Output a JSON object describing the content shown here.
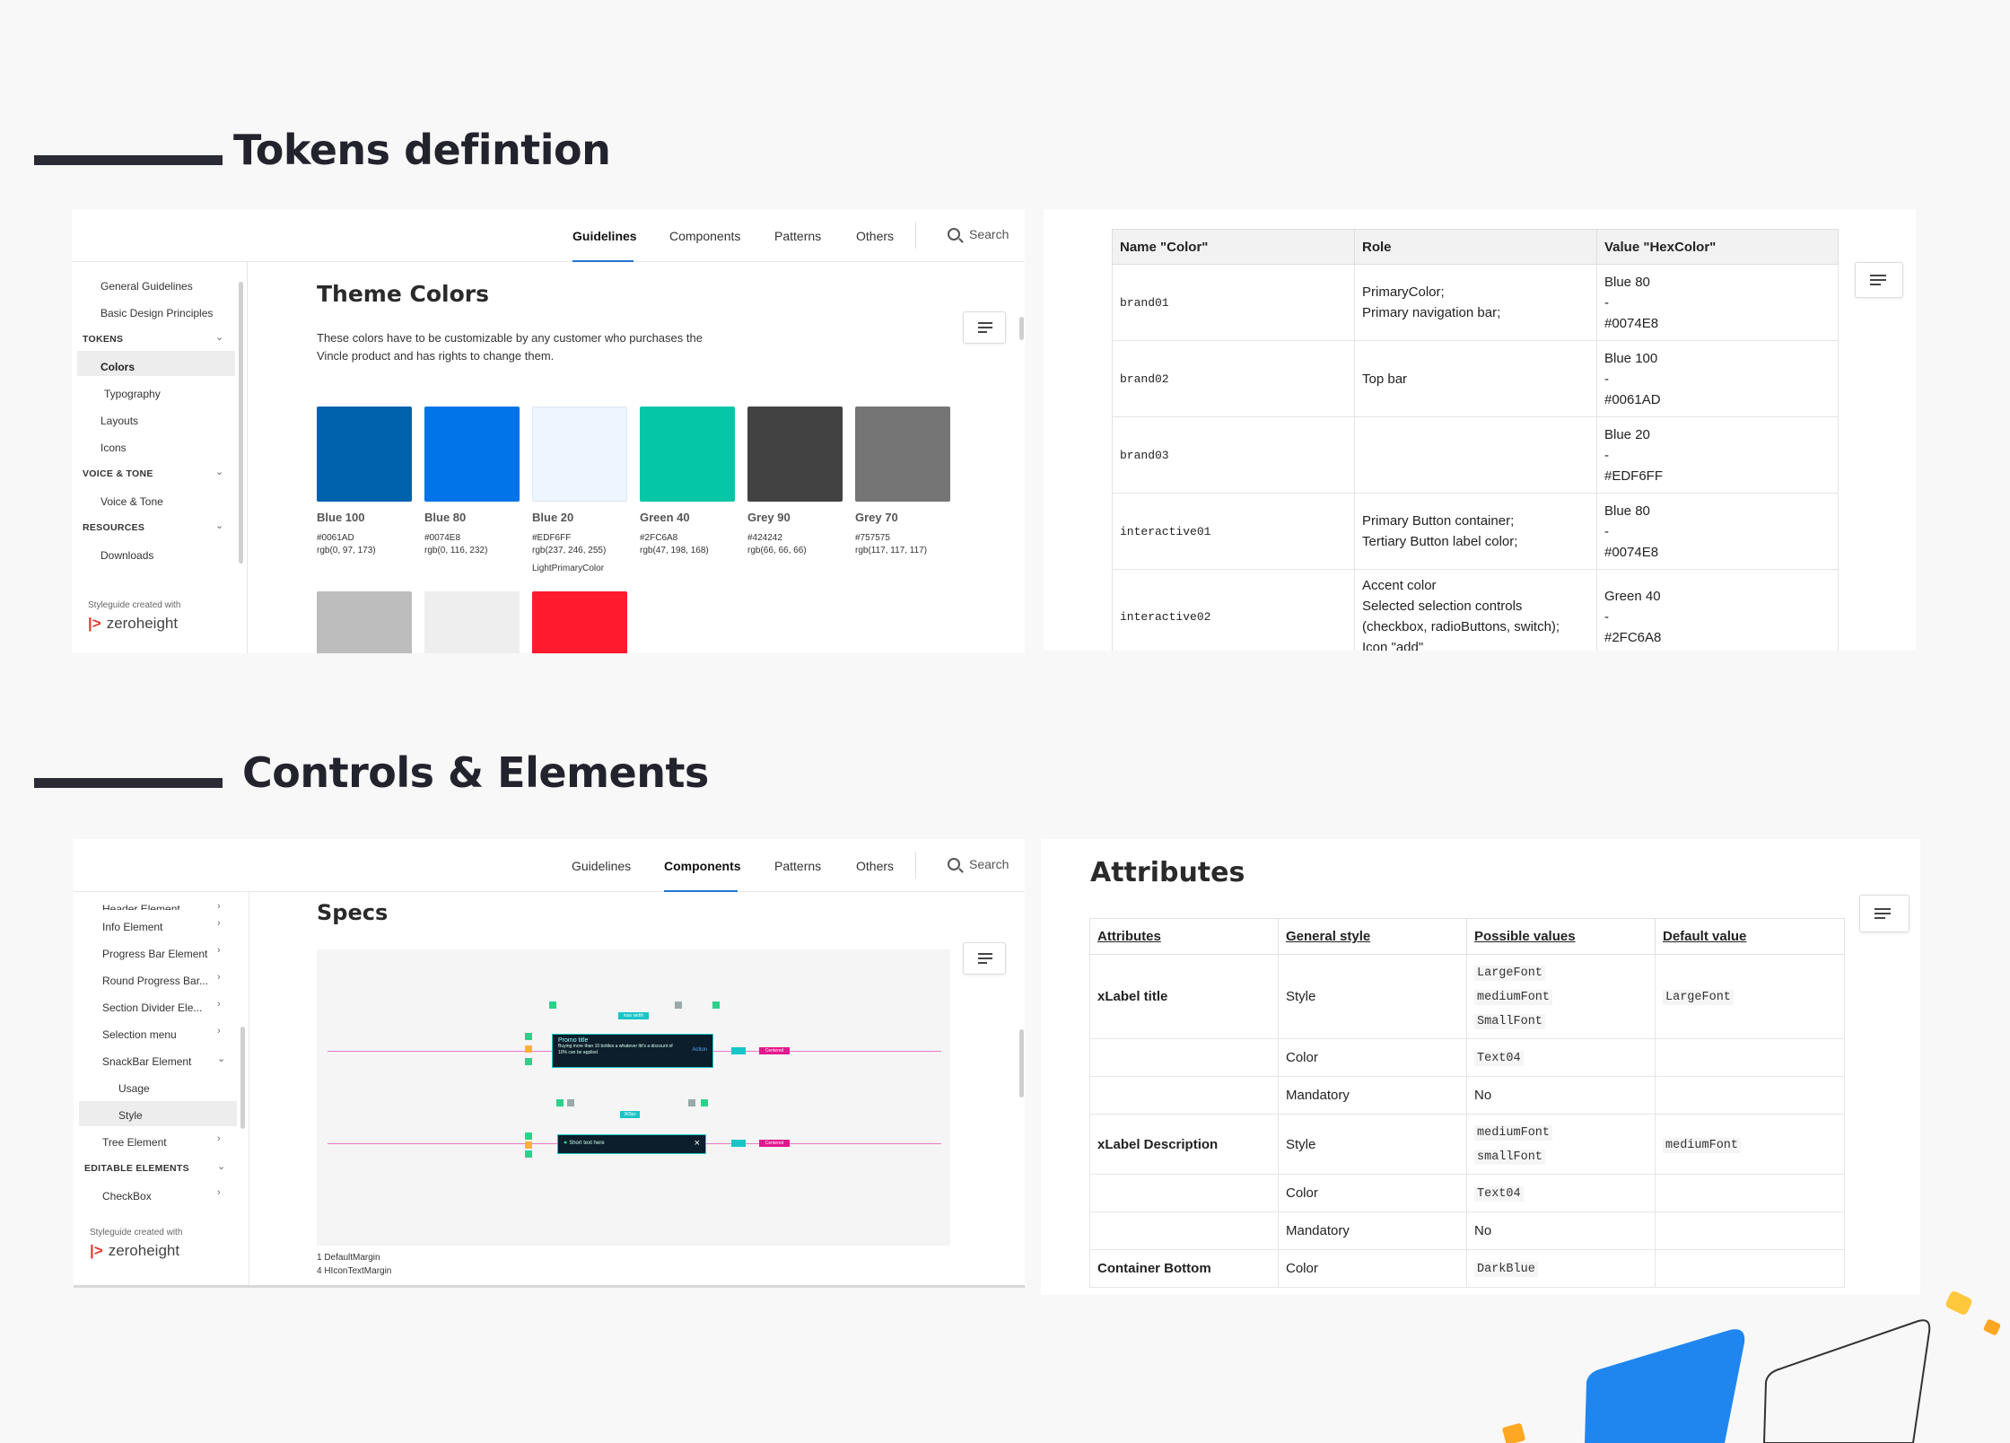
{
  "sections": {
    "tokens_title": "Tokens defintion",
    "controls_title": "Controls & Elements"
  },
  "nav": {
    "guidelines": "Guidelines",
    "components": "Components",
    "patterns": "Patterns",
    "others": "Others",
    "search": "Search"
  },
  "sidebar1": {
    "general": "General Guidelines",
    "basic": "Basic Design Principles",
    "tokens_group": "TOKENS",
    "colors": "Colors",
    "typography": "Typography",
    "layouts": "Layouts",
    "icons": "Icons",
    "voice_group": "VOICE & TONE",
    "voice": "Voice & Tone",
    "resources_group": "RESOURCES",
    "downloads": "Downloads",
    "created_with": "Styleguide created with",
    "brand": "zeroheight"
  },
  "theme": {
    "title": "Theme Colors",
    "desc_line1": "These colors have to be customizable by any customer who purchases the",
    "desc_line2": "Vincle product and has rights to change them.",
    "swatches": [
      {
        "name": "Blue 100",
        "hex": "#0061AD",
        "rgb": "rgb(0, 97, 173)",
        "color": "#0061AD",
        "extra": ""
      },
      {
        "name": "Blue 80",
        "hex": "#0074E8",
        "rgb": "rgb(0, 116, 232)",
        "color": "#0074E8",
        "extra": ""
      },
      {
        "name": "Blue 20",
        "hex": "#EDF6FF",
        "rgb": "rgb(237, 246, 255)",
        "color": "#EDF6FF",
        "extra": "LightPrimaryColor"
      },
      {
        "name": "Green 40",
        "hex": "#2FC6A8",
        "rgb": "rgb(47, 198, 168)",
        "color": "#06C6A8",
        "extra": ""
      },
      {
        "name": "Grey 90",
        "hex": "#424242",
        "rgb": "rgb(66, 66, 66)",
        "color": "#424242",
        "extra": ""
      },
      {
        "name": "Grey 70",
        "hex": "#757575",
        "rgb": "rgb(117, 117, 117)",
        "color": "#757575",
        "extra": ""
      }
    ],
    "row2_colors": [
      "#BDBDBD",
      "#EEEEEE",
      "#FF1A2E"
    ]
  },
  "tokens_table": {
    "headers": [
      "Name \"Color\"",
      "Role",
      "Value \"HexColor\""
    ],
    "rows": [
      {
        "name": "brand01",
        "role1": "PrimaryColor;",
        "role2": "Primary navigation bar;",
        "role3": "",
        "role4": "",
        "v1": "Blue 80",
        "v2": "-",
        "v3": "#0074E8"
      },
      {
        "name": "brand02",
        "role1": "Top bar",
        "role2": "",
        "role3": "",
        "role4": "",
        "v1": "Blue 100",
        "v2": "-",
        "v3": "#0061AD"
      },
      {
        "name": "brand03",
        "role1": "",
        "role2": "",
        "role3": "",
        "role4": "",
        "v1": "Blue 20",
        "v2": "-",
        "v3": "#EDF6FF"
      },
      {
        "name": "interactive01",
        "role1": "Primary Button container;",
        "role2": "Tertiary Button label color;",
        "role3": "",
        "role4": "",
        "v1": "Blue 80",
        "v2": "-",
        "v3": "#0074E8"
      },
      {
        "name": "interactive02",
        "role1": "Accent color",
        "role2": "Selected selection controls",
        "role3": "(checkbox, radioButtons, switch);",
        "role4": "Icon \"add\"",
        "v1": "Green 40",
        "v2": "-",
        "v3": "#2FC6A8"
      }
    ]
  },
  "sidebar2": {
    "header_el": "Header Element",
    "info": "Info Element",
    "progress": "Progress Bar Element",
    "round": "Round Progress Bar...",
    "section": "Section Divider Ele...",
    "selection": "Selection menu",
    "snackbar": "SnackBar Element",
    "usage": "Usage",
    "style": "Style",
    "tree": "Tree Element",
    "editable_group": "EDITABLE ELEMENTS",
    "checkbox": "CheckBox",
    "created_with": "Styleguide created with",
    "brand": "zeroheight"
  },
  "specs": {
    "title": "Specs",
    "note1": "1 DefaultMargin",
    "note2": "4 HIconTextMargin",
    "snack1_title": "Promo title",
    "snack1_text": "Buying more than 10 bottles a whatever lbl's a discount of 10% can be applied",
    "snack1_action": "Action",
    "snack2_text": "Short text here",
    "tag_max": "max width",
    "tag_min": "360px",
    "tag_centered": "Centered"
  },
  "attributes": {
    "title": "Attributes",
    "headers": [
      "Attributes",
      "General style",
      "Possible values",
      "Default value"
    ],
    "rows": [
      {
        "attr": "xLabel title",
        "style": "Style",
        "values": [
          "LargeFont",
          "mediumFont",
          "SmallFont"
        ],
        "default": "LargeFont",
        "plain": ""
      },
      {
        "attr": "",
        "style": "Color",
        "values": [
          "Text04"
        ],
        "default": "",
        "plain": ""
      },
      {
        "attr": "",
        "style": "Mandatory",
        "values": [],
        "default": "",
        "plain": "No"
      },
      {
        "attr": "xLabel Description",
        "style": "Style",
        "values": [
          "mediumFont",
          "smallFont"
        ],
        "default": "mediumFont",
        "plain": ""
      },
      {
        "attr": "",
        "style": "Color",
        "values": [
          "Text04"
        ],
        "default": "",
        "plain": ""
      },
      {
        "attr": "",
        "style": "Mandatory",
        "values": [],
        "default": "",
        "plain": "No"
      },
      {
        "attr": "Container Bottom",
        "style": "Color",
        "values": [
          "DarkBlue"
        ],
        "default": "",
        "plain": ""
      }
    ]
  },
  "colors": {
    "heading": "#23232d",
    "accent": "#1f75d6",
    "deco_blue": "#1f86f0",
    "deco_yellow": "#ffc83d",
    "deco_orange": "#ffa623"
  }
}
